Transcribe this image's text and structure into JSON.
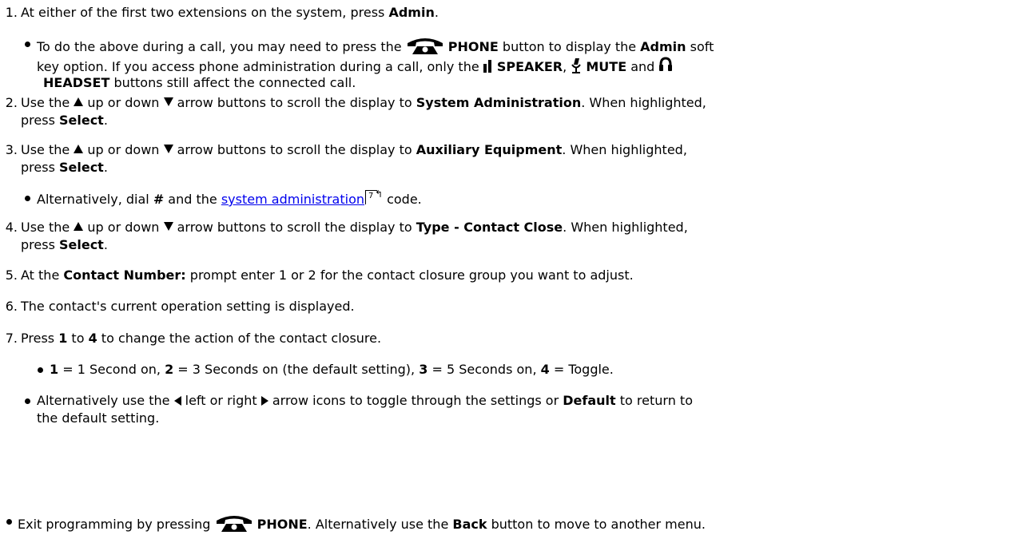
{
  "steps": {
    "s1": {
      "num": "1.",
      "t1": "At either of the first two extensions on the system, press ",
      "b1": "Admin",
      "t2": "."
    },
    "s1_note": {
      "t1": "To do the above during a call, you may need to press the ",
      "b_phone": "PHONE",
      "t2": " button to display the ",
      "b_admin": "Admin",
      "t3": " soft",
      "t4": "key option. If you access phone administration during a call, only the ",
      "b_speaker": "SPEAKER",
      "t5": ", ",
      "b_mute": "MUTE",
      "t6": " and ",
      "b_headset": "HEADSET",
      "t7": " buttons still affect the connected call."
    },
    "s2": {
      "num": "2.",
      "t1": "Use the ",
      "t2": " up or down ",
      "t3": " arrow buttons to scroll the display to ",
      "b1": "System Administration",
      "t4": ". When highlighted,",
      "t5": "press ",
      "b2": "Select",
      "t6": "."
    },
    "s3": {
      "num": "3.",
      "t1": "Use the ",
      "t2": " up or down ",
      "t3": " arrow buttons to scroll the display to ",
      "b1": "Auxiliary Equipment",
      "t4": ". When highlighted,",
      "t5": "press ",
      "b2": "Select",
      "t6": "."
    },
    "s3_note": {
      "t1": "Alternatively, dial ",
      "b1": "#",
      "t2": " and the ",
      "link": "system administration",
      "ref_page": "7",
      "t3": " code."
    },
    "s4": {
      "num": "4.",
      "t1": "Use the ",
      "t2": " up or down ",
      "t3": " arrow buttons to scroll the display to ",
      "b1": "Type - Contact Close",
      "t4": ". When highlighted,",
      "t5": "press ",
      "b2": "Select",
      "t6": "."
    },
    "s5": {
      "num": "5.",
      "t1": "At the ",
      "b1": "Contact Number:",
      "t2": " prompt enter 1 or 2 for the contact closure group you want to adjust."
    },
    "s6": {
      "num": "6.",
      "t1": "The contact's current operation setting is displayed."
    },
    "s7": {
      "num": "7.",
      "t1": "Press ",
      "b1": "1",
      "t2": " to ",
      "b2": "4",
      "t3": " to change the action of the contact closure."
    },
    "s7_opts": {
      "b1": "1",
      "t1": " = 1 Second on, ",
      "b2": "2",
      "t2": " = 3 Seconds on (the default setting), ",
      "b3": "3",
      "t3": " = 5 Seconds on, ",
      "b4": "4",
      "t4": " = Toggle."
    },
    "s7_note": {
      "t1": "Alternatively use the ",
      "t2": " left or right ",
      "t3": " arrow icons to toggle through the settings or ",
      "b1": "Default",
      "t4": " to return to",
      "t5": "the default setting."
    },
    "exit": {
      "t1": "Exit programming by pressing ",
      "b1": "PHONE",
      "t2": ". Alternatively use the ",
      "b2": "Back",
      "t3": " button to move to another menu."
    }
  },
  "icons": {
    "phone": "phone-icon",
    "speaker": "speaker-icon",
    "mute": "mute-microphone-icon",
    "headset": "headset-icon",
    "up": "up-arrow-icon",
    "down": "down-arrow-icon",
    "left": "left-arrow-icon",
    "right": "right-arrow-icon",
    "crossref": "page-reference-icon"
  }
}
